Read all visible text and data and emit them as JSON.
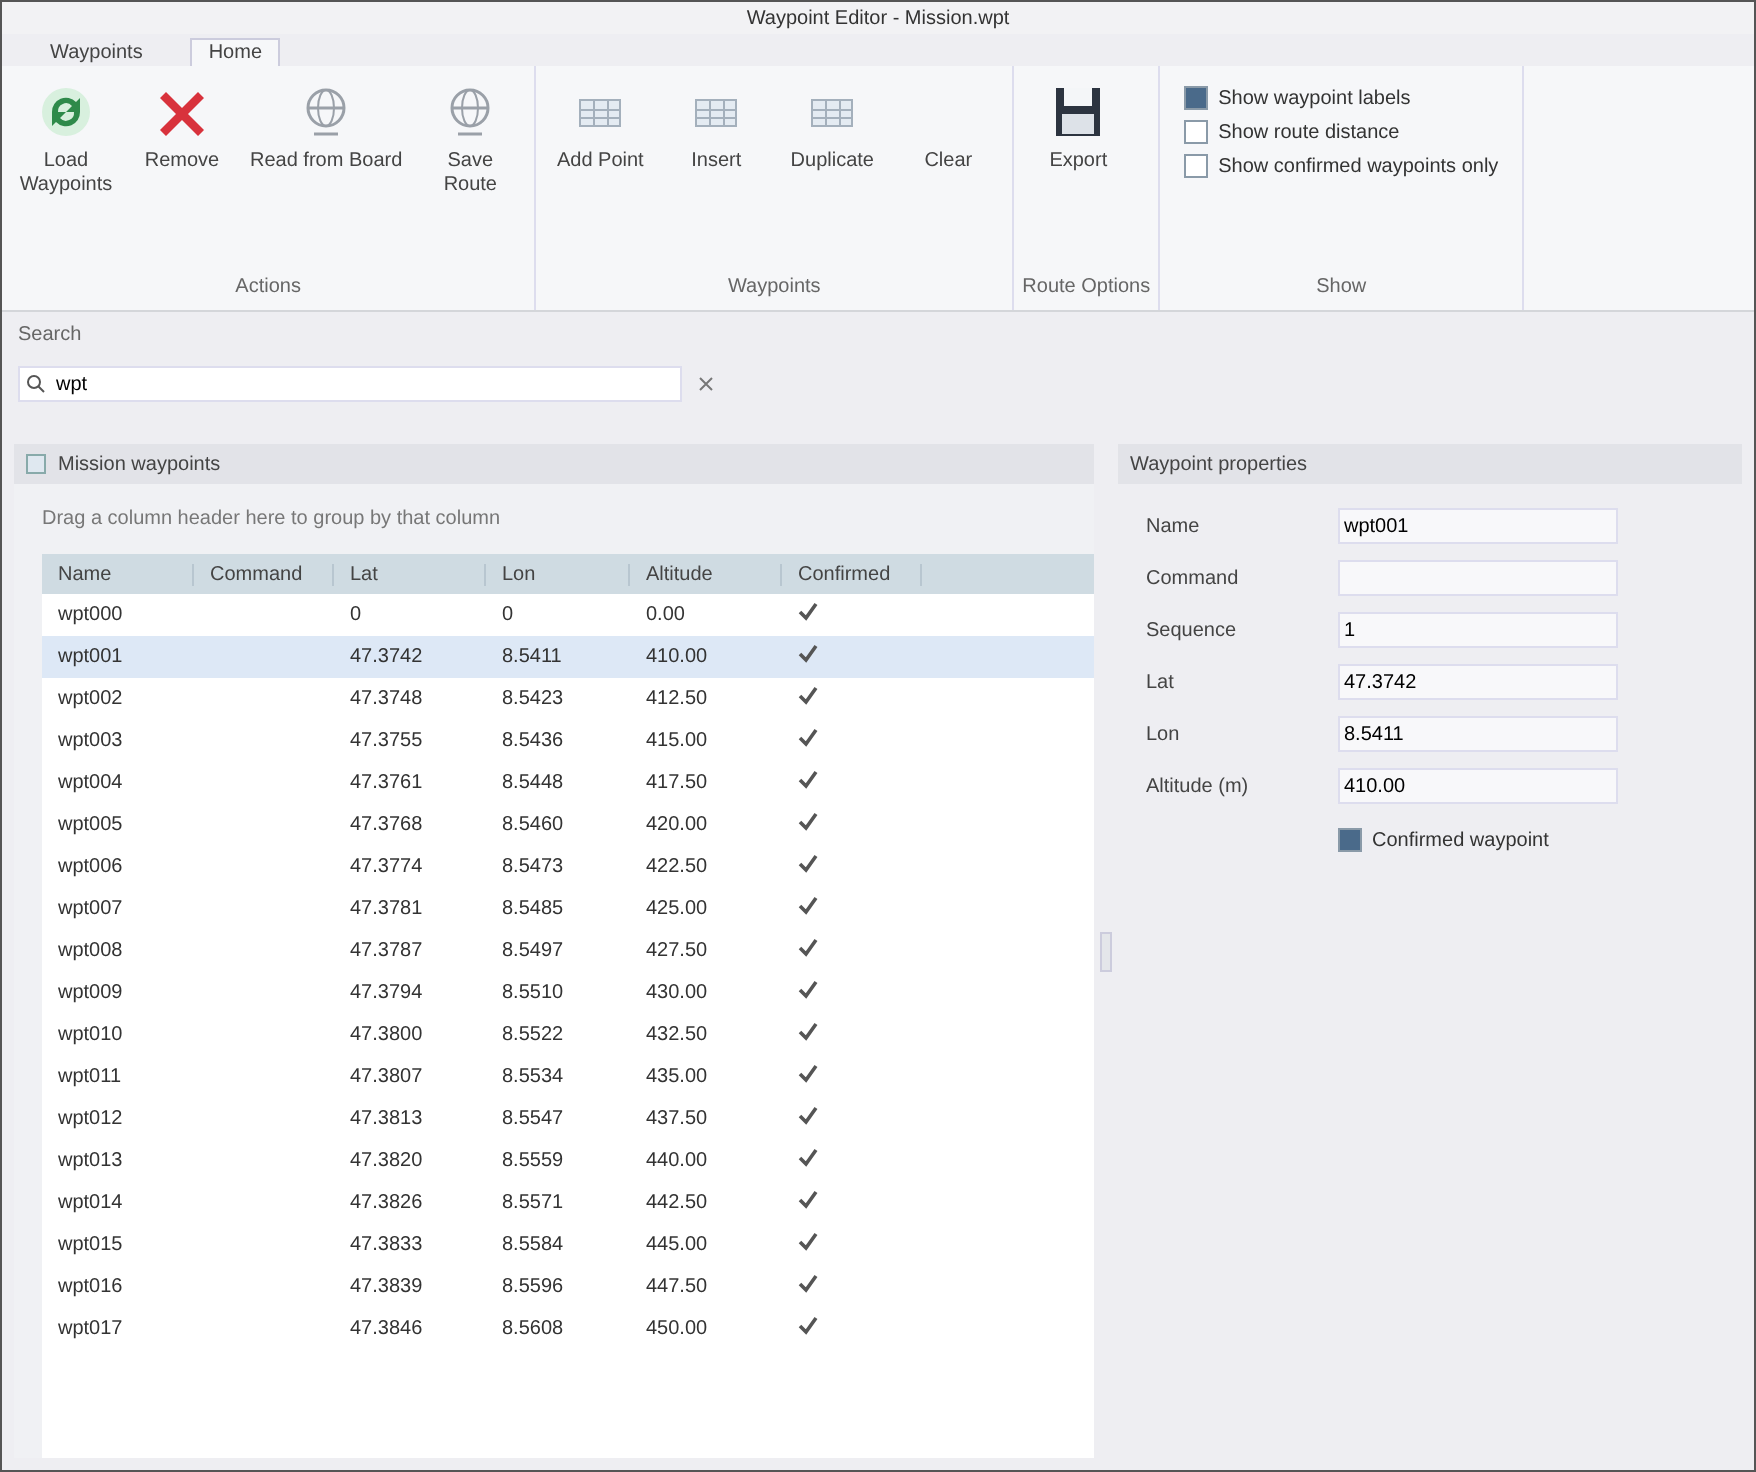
{
  "window": {
    "title": "Waypoint Editor - Mission.wpt"
  },
  "tabs": [
    {
      "label": "Waypoints",
      "selected": false
    },
    {
      "label": "Home",
      "selected": true
    }
  ],
  "ribbon": {
    "groups": [
      {
        "label": "Actions",
        "buttons": [
          {
            "label": "Load\nWaypoints",
            "kind": "refresh"
          },
          {
            "label": "Remove",
            "kind": "delete"
          },
          {
            "label": "Read from Board",
            "kind": "globe"
          },
          {
            "label": "Save\nRoute",
            "kind": "globe"
          }
        ]
      },
      {
        "label": "Waypoints",
        "buttons": [
          {
            "label": "Add Point",
            "kind": "grid"
          },
          {
            "label": "Insert",
            "kind": "grid"
          },
          {
            "label": "Duplicate",
            "kind": "grid"
          },
          {
            "label": "Clear",
            "kind": "text"
          }
        ]
      },
      {
        "label": "Route Options",
        "buttons": [
          {
            "label": "Export",
            "kind": "save"
          }
        ]
      },
      {
        "label": "Show",
        "checks": [
          {
            "label": "Show waypoint labels",
            "checked": true
          },
          {
            "label": "Show route distance",
            "checked": false
          },
          {
            "label": "Show confirmed waypoints only",
            "checked": false
          }
        ]
      }
    ]
  },
  "search": {
    "label": "Search",
    "value": "wpt"
  },
  "grid_panel": {
    "title": "Mission waypoints",
    "hint": "Drag a column header here to group by that column",
    "columns": [
      "Name",
      "Command",
      "Lat",
      "Lon",
      "Altitude",
      "Confirmed"
    ],
    "rows": [
      {
        "cells": [
          "wpt000",
          "",
          "0",
          "0",
          "0.00"
        ],
        "confirmed": true,
        "selected": false
      },
      {
        "cells": [
          "wpt001",
          "",
          "47.3742",
          "8.5411",
          "410.00"
        ],
        "confirmed": true,
        "selected": true
      },
      {
        "cells": [
          "wpt002",
          "",
          "47.3748",
          "8.5423",
          "412.50"
        ],
        "confirmed": true,
        "selected": false
      },
      {
        "cells": [
          "wpt003",
          "",
          "47.3755",
          "8.5436",
          "415.00"
        ],
        "confirmed": true,
        "selected": false
      },
      {
        "cells": [
          "wpt004",
          "",
          "47.3761",
          "8.5448",
          "417.50"
        ],
        "confirmed": true,
        "selected": false
      },
      {
        "cells": [
          "wpt005",
          "",
          "47.3768",
          "8.5460",
          "420.00"
        ],
        "confirmed": true,
        "selected": false
      },
      {
        "cells": [
          "wpt006",
          "",
          "47.3774",
          "8.5473",
          "422.50"
        ],
        "confirmed": true,
        "selected": false
      },
      {
        "cells": [
          "wpt007",
          "",
          "47.3781",
          "8.5485",
          "425.00"
        ],
        "confirmed": true,
        "selected": false
      },
      {
        "cells": [
          "wpt008",
          "",
          "47.3787",
          "8.5497",
          "427.50"
        ],
        "confirmed": true,
        "selected": false
      },
      {
        "cells": [
          "wpt009",
          "",
          "47.3794",
          "8.5510",
          "430.00"
        ],
        "confirmed": true,
        "selected": false
      },
      {
        "cells": [
          "wpt010",
          "",
          "47.3800",
          "8.5522",
          "432.50"
        ],
        "confirmed": true,
        "selected": false
      },
      {
        "cells": [
          "wpt011",
          "",
          "47.3807",
          "8.5534",
          "435.00"
        ],
        "confirmed": true,
        "selected": false
      },
      {
        "cells": [
          "wpt012",
          "",
          "47.3813",
          "8.5547",
          "437.50"
        ],
        "confirmed": true,
        "selected": false
      },
      {
        "cells": [
          "wpt013",
          "",
          "47.3820",
          "8.5559",
          "440.00"
        ],
        "confirmed": true,
        "selected": false
      },
      {
        "cells": [
          "wpt014",
          "",
          "47.3826",
          "8.5571",
          "442.50"
        ],
        "confirmed": true,
        "selected": false
      },
      {
        "cells": [
          "wpt015",
          "",
          "47.3833",
          "8.5584",
          "445.00"
        ],
        "confirmed": true,
        "selected": false
      },
      {
        "cells": [
          "wpt016",
          "",
          "47.3839",
          "8.5596",
          "447.50"
        ],
        "confirmed": true,
        "selected": false
      },
      {
        "cells": [
          "wpt017",
          "",
          "47.3846",
          "8.5608",
          "450.00"
        ],
        "confirmed": true,
        "selected": false
      }
    ]
  },
  "properties": {
    "title": "Waypoint properties",
    "fields": [
      {
        "label": "Name",
        "value": "wpt001"
      },
      {
        "label": "Command"
      },
      {
        "label": "Sequence",
        "value": "1"
      },
      {
        "label": "Lat",
        "value": "47.3742"
      },
      {
        "label": "Lon",
        "value": "8.5411"
      },
      {
        "label": "Altitude (m)",
        "value": "410.00"
      }
    ],
    "check": {
      "label": "Confirmed waypoint",
      "checked": true
    }
  }
}
